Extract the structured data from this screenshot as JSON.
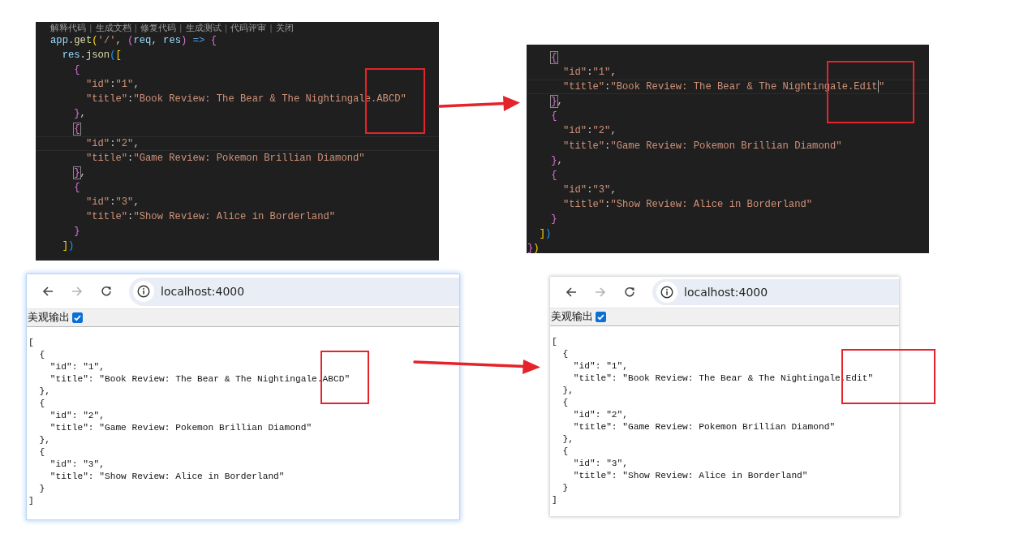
{
  "editors": [
    {
      "codelens": [
        {
          "kind": "link",
          "text": "解释代码"
        },
        {
          "kind": "sep",
          "text": "|"
        },
        {
          "kind": "link",
          "text": "生成文档"
        },
        {
          "kind": "sep",
          "text": "|"
        },
        {
          "kind": "link",
          "text": "修复代码"
        },
        {
          "kind": "sep",
          "text": "|"
        },
        {
          "kind": "link",
          "text": "生成测试"
        },
        {
          "kind": "sep",
          "text": "|"
        },
        {
          "kind": "link",
          "text": "代码评审"
        },
        {
          "kind": "sep",
          "text": "|"
        },
        {
          "kind": "link",
          "text": "关闭"
        }
      ],
      "lines": [
        {
          "kind": "statement",
          "current": false,
          "tokens": [
            {
              "kind": "var",
              "text": "app"
            },
            {
              "kind": "punct",
              "text": "."
            },
            {
              "kind": "fn",
              "text": "get"
            },
            {
              "kind": "b1",
              "text": "("
            },
            {
              "kind": "str",
              "text": "'/'"
            },
            {
              "kind": "punct",
              "text": ","
            },
            {
              "kind": "b2",
              "text": "("
            },
            {
              "kind": "var",
              "text": "req"
            },
            {
              "kind": "punct",
              "text": ","
            },
            {
              "kind": "var",
              "text": "res"
            },
            {
              "kind": "b2",
              "text": ")"
            },
            {
              "kind": "kw",
              "text": "=>"
            },
            {
              "kind": "b2",
              "text": "{"
            }
          ]
        },
        {
          "kind": "call",
          "current": false,
          "tokens": [
            {
              "kind": "var",
              "text": "res"
            },
            {
              "kind": "punct",
              "text": "."
            },
            {
              "kind": "fn",
              "text": "json"
            },
            {
              "kind": "b3",
              "text": "("
            },
            {
              "kind": "b1",
              "text": "["
            }
          ]
        },
        {
          "kind": "object",
          "current": false,
          "tokens": [
            {
              "kind": "b2",
              "text": "{"
            }
          ]
        },
        {
          "kind": "field",
          "current": false,
          "tokens": [
            {
              "kind": "str",
              "text": "\"id\""
            },
            {
              "kind": "punct",
              "text": ":"
            },
            {
              "kind": "str",
              "text": "\"1\""
            },
            {
              "kind": "punct",
              "text": ","
            }
          ]
        },
        {
          "kind": "field",
          "current": false,
          "tokens": [
            {
              "kind": "str",
              "text": "\"title\""
            },
            {
              "kind": "punct",
              "text": ":"
            },
            {
              "kind": "str",
              "text": "\"Book Review: The Bear & The Nightingale.ABCD\""
            }
          ]
        },
        {
          "kind": "object",
          "current": false,
          "tokens": [
            {
              "kind": "b2",
              "text": "}"
            },
            {
              "kind": "punct",
              "text": ","
            }
          ]
        },
        {
          "kind": "object",
          "current": false,
          "tokens": [
            {
              "kind": "b2",
              "text": "{",
              "matched": true
            }
          ]
        },
        {
          "kind": "field",
          "current": true,
          "tokens": [
            {
              "kind": "str",
              "text": "\"id\""
            },
            {
              "kind": "punct",
              "text": ":"
            },
            {
              "kind": "str",
              "text": "\"2\""
            },
            {
              "kind": "punct",
              "text": ","
            }
          ]
        },
        {
          "kind": "field",
          "current": false,
          "tokens": [
            {
              "kind": "str",
              "text": "\"title\""
            },
            {
              "kind": "punct",
              "text": ":"
            },
            {
              "kind": "str",
              "text": "\"Game Review: Pokemon Brillian Diamond\""
            }
          ]
        },
        {
          "kind": "object",
          "current": false,
          "tokens": [
            {
              "kind": "b2",
              "text": "}",
              "matched": true
            },
            {
              "kind": "punct",
              "text": ","
            }
          ]
        },
        {
          "kind": "object",
          "current": false,
          "tokens": [
            {
              "kind": "b2",
              "text": "{"
            }
          ]
        },
        {
          "kind": "field",
          "current": false,
          "tokens": [
            {
              "kind": "str",
              "text": "\"id\""
            },
            {
              "kind": "punct",
              "text": ":"
            },
            {
              "kind": "str",
              "text": "\"3\""
            },
            {
              "kind": "punct",
              "text": ","
            }
          ]
        },
        {
          "kind": "field",
          "current": false,
          "tokens": [
            {
              "kind": "str",
              "text": "\"title\""
            },
            {
              "kind": "punct",
              "text": ":"
            },
            {
              "kind": "str",
              "text": "\"Show Review: Alice in Borderland\""
            }
          ]
        },
        {
          "kind": "object",
          "current": false,
          "tokens": [
            {
              "kind": "b2",
              "text": "}"
            }
          ]
        },
        {
          "kind": "call",
          "current": false,
          "tokens": [
            {
              "kind": "b1",
              "text": "]"
            },
            {
              "kind": "b3",
              "text": ")"
            }
          ]
        }
      ]
    },
    {
      "lines": [
        {
          "kind": "object",
          "current": false,
          "tokens": [
            {
              "kind": "b2",
              "text": "{",
              "matched": true
            }
          ]
        },
        {
          "kind": "field",
          "current": false,
          "tokens": [
            {
              "kind": "str",
              "text": "\"id\""
            },
            {
              "kind": "punct",
              "text": ":"
            },
            {
              "kind": "str",
              "text": "\"1\""
            },
            {
              "kind": "punct",
              "text": ","
            }
          ]
        },
        {
          "kind": "field",
          "current": true,
          "tokens": [
            {
              "kind": "str",
              "text": "\"title\""
            },
            {
              "kind": "punct",
              "text": ":"
            },
            {
              "kind": "str",
              "text": "\"Book Review: The Bear & The Nightingale.Edit"
            },
            {
              "kind": "cursor"
            },
            {
              "kind": "str",
              "text": "\""
            }
          ]
        },
        {
          "kind": "object",
          "current": false,
          "tokens": [
            {
              "kind": "b2",
              "text": "}",
              "matched": true
            },
            {
              "kind": "punct",
              "text": ","
            }
          ]
        },
        {
          "kind": "object",
          "current": false,
          "tokens": [
            {
              "kind": "b2",
              "text": "{"
            }
          ]
        },
        {
          "kind": "field",
          "current": false,
          "tokens": [
            {
              "kind": "str",
              "text": "\"id\""
            },
            {
              "kind": "punct",
              "text": ":"
            },
            {
              "kind": "str",
              "text": "\"2\""
            },
            {
              "kind": "punct",
              "text": ","
            }
          ]
        },
        {
          "kind": "field",
          "current": false,
          "tokens": [
            {
              "kind": "str",
              "text": "\"title\""
            },
            {
              "kind": "punct",
              "text": ":"
            },
            {
              "kind": "str",
              "text": "\"Game Review: Pokemon Brillian Diamond\""
            }
          ]
        },
        {
          "kind": "object",
          "current": false,
          "tokens": [
            {
              "kind": "b2",
              "text": "}"
            },
            {
              "kind": "punct",
              "text": ","
            }
          ]
        },
        {
          "kind": "object",
          "current": false,
          "tokens": [
            {
              "kind": "b2",
              "text": "{"
            }
          ]
        },
        {
          "kind": "field",
          "current": false,
          "tokens": [
            {
              "kind": "str",
              "text": "\"id\""
            },
            {
              "kind": "punct",
              "text": ":"
            },
            {
              "kind": "str",
              "text": "\"3\""
            },
            {
              "kind": "punct",
              "text": ","
            }
          ]
        },
        {
          "kind": "field",
          "current": false,
          "tokens": [
            {
              "kind": "str",
              "text": "\"title\""
            },
            {
              "kind": "punct",
              "text": ":"
            },
            {
              "kind": "str",
              "text": "\"Show Review: Alice in Borderland\""
            }
          ]
        },
        {
          "kind": "object",
          "current": false,
          "tokens": [
            {
              "kind": "b2",
              "text": "}"
            }
          ]
        },
        {
          "kind": "call",
          "current": false,
          "tokens": [
            {
              "kind": "b1",
              "text": "]"
            },
            {
              "kind": "b3",
              "text": ")"
            }
          ]
        },
        {
          "kind": "statement",
          "current": false,
          "tokens": [
            {
              "kind": "b2",
              "text": "}"
            },
            {
              "kind": "b1",
              "text": ")"
            }
          ]
        }
      ]
    }
  ],
  "browsers": [
    {
      "nav": [
        {
          "kind": "back",
          "disabled": false
        },
        {
          "kind": "forward",
          "disabled": true
        },
        {
          "kind": "reload",
          "disabled": false
        }
      ],
      "address": "localhost:4000",
      "pretty_print": {
        "label": "美观输出",
        "checked": true
      },
      "output_lines": [
        "[",
        "{",
        "\"id\": \"1\",",
        "\"title\": \"Book Review: The Bear & The Nightingale.ABCD\"",
        "},",
        "{",
        "\"id\": \"2\",",
        "\"title\": \"Game Review: Pokemon Brillian Diamond\"",
        "},",
        "{",
        "\"id\": \"3\",",
        "\"title\": \"Show Review: Alice in Borderland\"",
        "}",
        "]"
      ]
    },
    {
      "nav": [
        {
          "kind": "back",
          "disabled": false
        },
        {
          "kind": "forward",
          "disabled": true
        },
        {
          "kind": "reload",
          "disabled": false
        }
      ],
      "address": "localhost:4000",
      "pretty_print": {
        "label": "美观输出",
        "checked": true
      },
      "output_lines": [
        "[",
        "{",
        "\"id\": \"1\",",
        "\"title\": \"Book Review: The Bear & The Nightingale.Edit\"",
        "},",
        "{",
        "\"id\": \"2\",",
        "\"title\": \"Game Review: Pokemon Brillian Diamond\"",
        "},",
        "{",
        "\"id\": \"3\",",
        "\"title\": \"Show Review: Alice in Borderland\"",
        "}",
        "]"
      ]
    }
  ]
}
